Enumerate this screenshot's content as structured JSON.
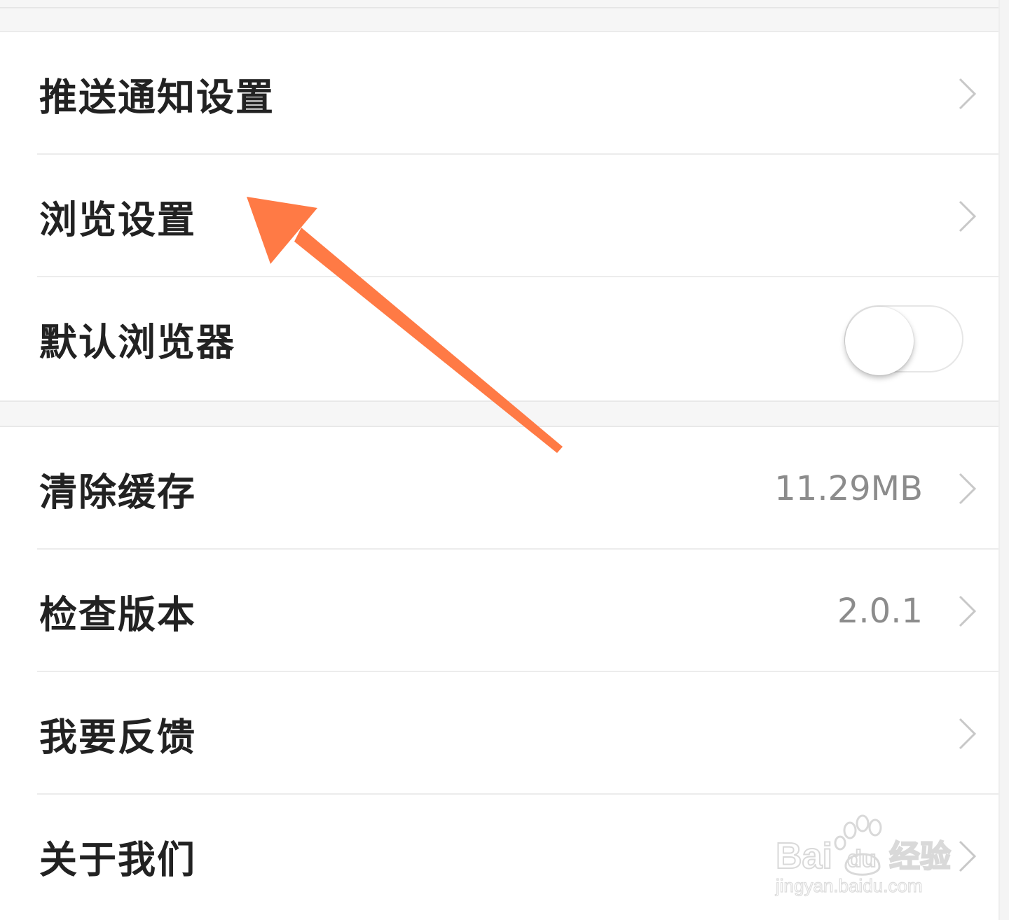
{
  "settings": {
    "group1": [
      {
        "label": "推送通知设置",
        "type": "nav"
      },
      {
        "label": "浏览设置",
        "type": "nav"
      },
      {
        "label": "默认浏览器",
        "type": "toggle",
        "enabled": false
      }
    ],
    "group2": [
      {
        "label": "清除缓存",
        "value": "11.29MB",
        "type": "nav"
      },
      {
        "label": "检查版本",
        "value": "2.0.1",
        "type": "nav"
      },
      {
        "label": "我要反馈",
        "type": "nav"
      },
      {
        "label": "关于我们",
        "type": "nav"
      }
    ]
  },
  "annotation": {
    "color": "#ff7a45",
    "points_to": "浏览设置"
  },
  "watermark": {
    "brand": "Bai",
    "brand_suffix": "du",
    "product": "经验",
    "url": "jingyan.baidu.com"
  },
  "icons": {
    "chevron": "chevron-right-icon",
    "paw": "baidu-paw-icon"
  },
  "colors": {
    "label": "#222222",
    "value": "#8c8c8c",
    "divider": "#ececec",
    "background": "#f5f5f5"
  }
}
